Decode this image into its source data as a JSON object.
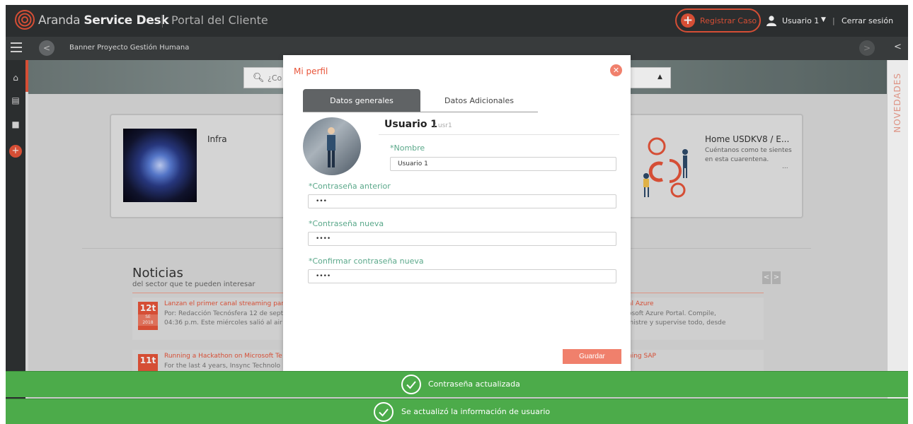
{
  "header": {
    "brand_light": "Aranda ",
    "brand_bold": "Service Desk",
    "portal": "Portal del Cliente",
    "register_case": "Registrar Caso",
    "user": "Usuario 1",
    "logout": "Cerrar sesión"
  },
  "subbar": {
    "banner_title": "Banner Proyecto Gestión Humana"
  },
  "search": {
    "placeholder": "¿Co"
  },
  "novedades": "NOVEDADES",
  "cards": {
    "infra": "Infra",
    "home_title": "Home USDKV8 / E...",
    "home_desc": "Cuéntanos como te sientes en esta cuarentena.",
    "home_more": "..."
  },
  "news": {
    "title": "Noticias",
    "subtitle": "del sector que te pueden interesar",
    "items": [
      {
        "day": "12t",
        "month": "SE",
        "year": "2018",
        "headline": "Lanzan el primer canal streaming par",
        "body1": "Por: Redacción Tecnósfera 12 de sept",
        "body2": "04:36 p.m. Este miércoles salió al air",
        "right_headline": "al Azure",
        "right_body1": "osoft Azure Portal. Compile,",
        "right_body2": "inistre y supervise todo, desde"
      },
      {
        "day": "11t",
        "headline": "Running a Hackathon on Microsoft Te",
        "body1": "For the last 4 years, Insync Technolo",
        "right_headline": "ning SAP"
      }
    ]
  },
  "modal": {
    "title": "Mi perfil",
    "tab_general": "Datos generales",
    "tab_additional": "Datos Adicionales",
    "profile_name": "Usuario 1",
    "profile_user": "/ usr1",
    "name_label": "*Nombre",
    "name_value": "Usuario 1",
    "old_password_label": "*Contraseña anterior",
    "old_password_value": "•••",
    "new_password_label": "*Contraseña nueva",
    "new_password_value": "••••",
    "confirm_password_label": "*Confirmar contraseña nueva",
    "confirm_password_value": "••••",
    "save": "Guardar"
  },
  "toasts": {
    "password_updated": "Contraseña actualizada",
    "user_updated": "Se actualizó la información de usuario"
  },
  "colors": {
    "accent": "#e8553a",
    "success": "#4cab4a",
    "topbar": "#2f3233",
    "label_green": "#5aa88a"
  }
}
